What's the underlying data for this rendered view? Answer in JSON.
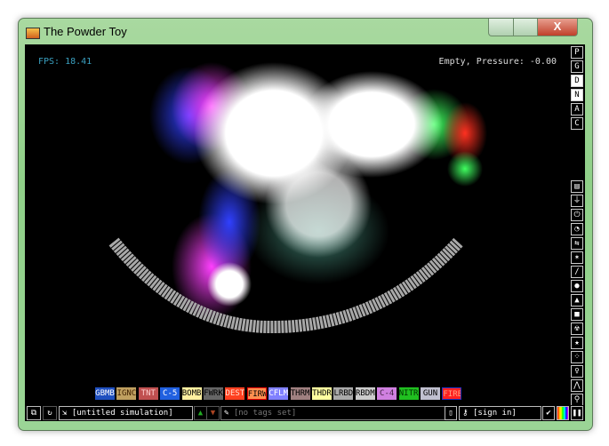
{
  "window": {
    "title": "The Powder Toy",
    "close_label": "X"
  },
  "hud": {
    "fps": "FPS: 18.41",
    "status": "Empty, Pressure: -0.00"
  },
  "render_modes": [
    {
      "label": "P",
      "active": false
    },
    {
      "label": "G",
      "active": false
    },
    {
      "label": "D",
      "active": true
    },
    {
      "label": "N",
      "active": true
    },
    {
      "label": "A",
      "active": false
    },
    {
      "label": "C",
      "active": false
    }
  ],
  "menu_sections": [
    {
      "name": "walls-icon",
      "glyph": "▤"
    },
    {
      "name": "electronics-icon",
      "glyph": "⏚"
    },
    {
      "name": "powered-icon",
      "glyph": "⏻"
    },
    {
      "name": "sensors-icon",
      "glyph": "◔"
    },
    {
      "name": "force-icon",
      "glyph": "⇆"
    },
    {
      "name": "explosives-icon",
      "glyph": "✶"
    },
    {
      "name": "gases-icon",
      "glyph": "∕"
    },
    {
      "name": "liquids-icon",
      "glyph": "●"
    },
    {
      "name": "powders-icon",
      "glyph": "▲"
    },
    {
      "name": "solids-icon",
      "glyph": "■"
    },
    {
      "name": "radioactive-icon",
      "glyph": "☢"
    },
    {
      "name": "special-icon",
      "glyph": "★"
    },
    {
      "name": "life-icon",
      "glyph": "⁘"
    },
    {
      "name": "tools-icon",
      "glyph": "♀"
    },
    {
      "name": "favorites-icon",
      "glyph": "⋀"
    },
    {
      "name": "search-icon",
      "glyph": "⚲"
    }
  ],
  "elements": [
    {
      "label": "GBMB",
      "bg": "#1f4fbf",
      "fg": "#ffffff"
    },
    {
      "label": "IGNC",
      "bg": "#c0a060",
      "fg": "#402000"
    },
    {
      "label": "TNT",
      "bg": "#c05050",
      "fg": "#ffd0d0"
    },
    {
      "label": "C-5",
      "bg": "#2060e0",
      "fg": "#ffffff"
    },
    {
      "label": "BOMB",
      "bg": "#fff0a0",
      "fg": "#000000"
    },
    {
      "label": "FWRK",
      "bg": "#666666",
      "fg": "#000000"
    },
    {
      "label": "DEST",
      "bg": "#ff4020",
      "fg": "#ffe0d0"
    },
    {
      "label": "FIRW",
      "bg": "#ff9050",
      "fg": "#000000",
      "selected": "left"
    },
    {
      "label": "CFLM",
      "bg": "#8080ff",
      "fg": "#ffffff"
    },
    {
      "label": "THRM",
      "bg": "#a08080",
      "fg": "#000000"
    },
    {
      "label": "THDR",
      "bg": "#ffffa0",
      "fg": "#000000"
    },
    {
      "label": "LRBD",
      "bg": "#aaaaaa",
      "fg": "#000000"
    },
    {
      "label": "RBDM",
      "bg": "#cccccc",
      "fg": "#000000"
    },
    {
      "label": "C-4",
      "bg": "#d080e0",
      "fg": "#402040"
    },
    {
      "label": "NITR",
      "bg": "#20c020",
      "fg": "#003000"
    },
    {
      "label": "GUN",
      "bg": "#c0c0d0",
      "fg": "#000000"
    },
    {
      "label": "FIRE",
      "bg": "#ff2020",
      "fg": "#ffa080",
      "selected": "right"
    }
  ],
  "bottom": {
    "save_title": "[untitled simulation]",
    "tags": "[no tags set]",
    "sign_in": "[sign in]"
  }
}
